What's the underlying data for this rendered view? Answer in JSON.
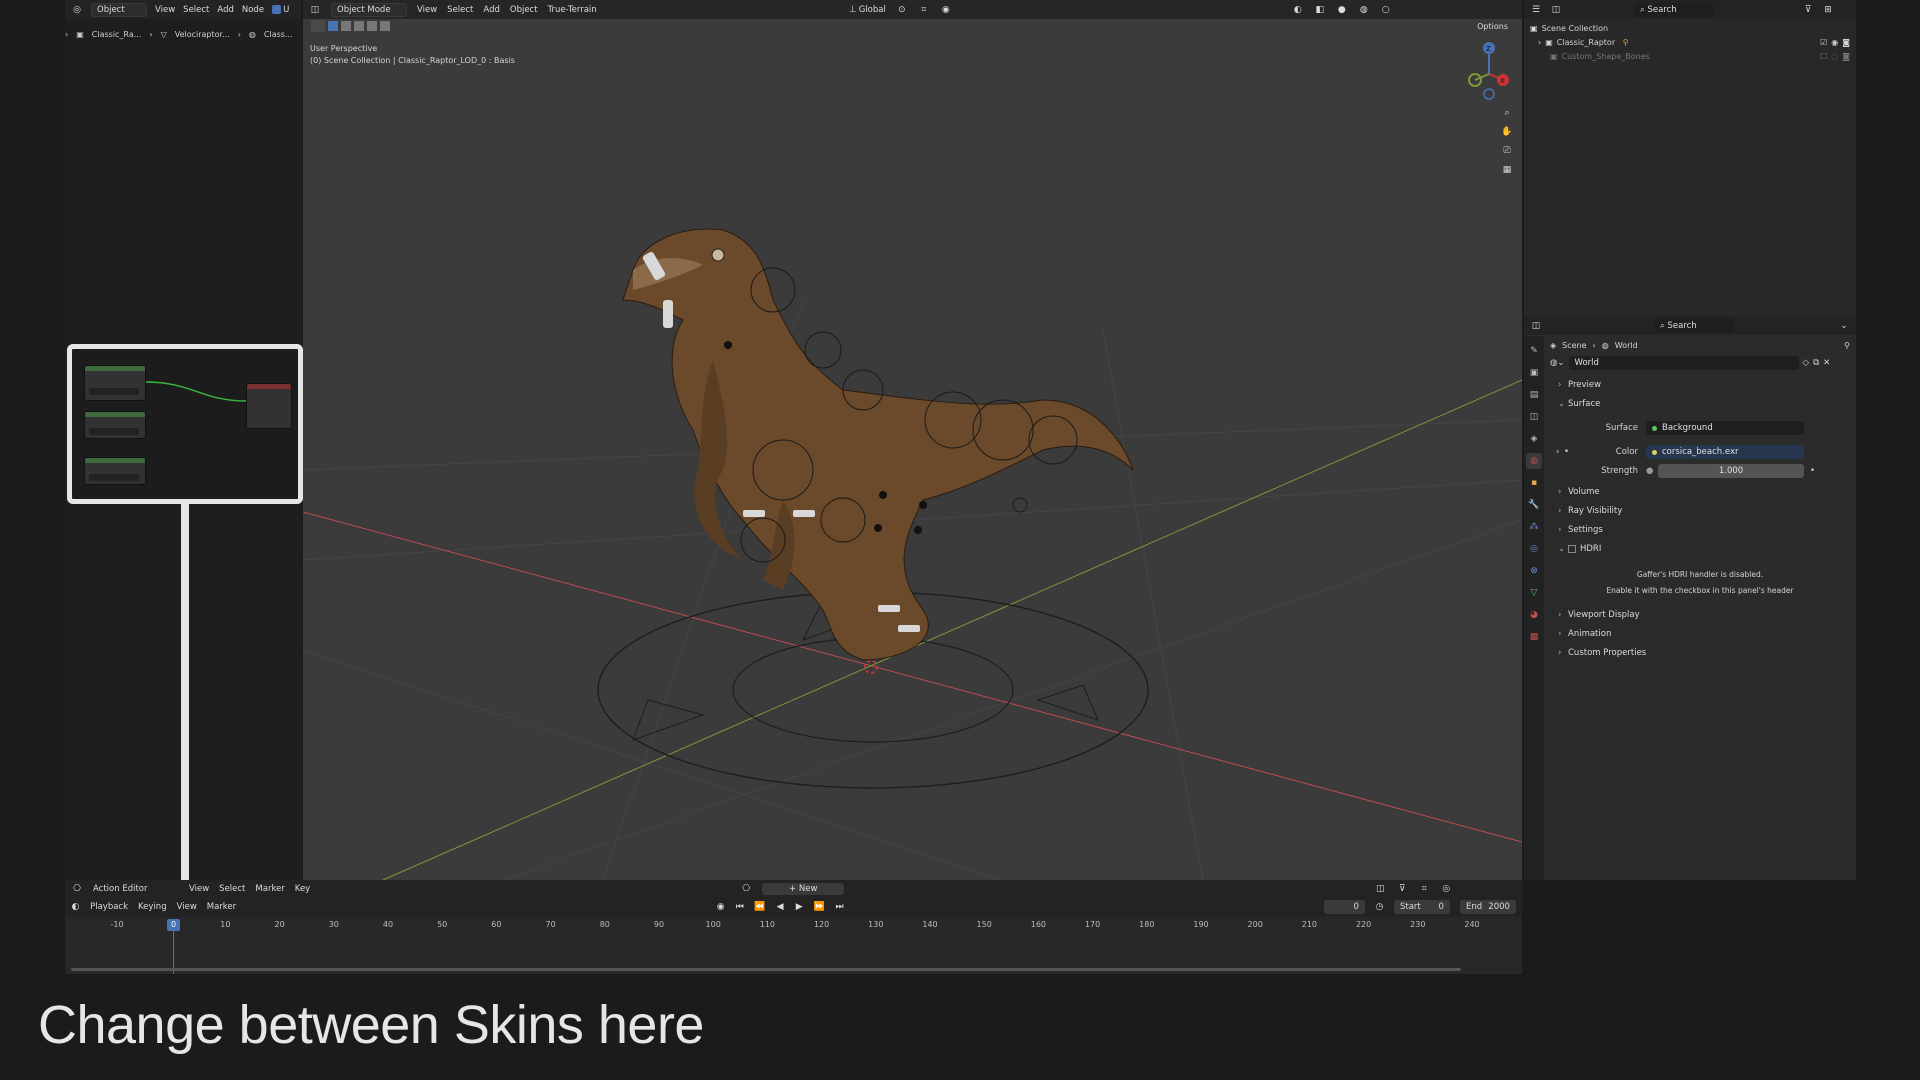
{
  "node_editor": {
    "header": {
      "mode": "Object",
      "menus": [
        "View",
        "Select",
        "Add",
        "Node"
      ],
      "checkbox_label": "U"
    },
    "breadcrumb": [
      "Classic_Ra...",
      "Velociraptor...",
      "Class..."
    ]
  },
  "viewport": {
    "header": {
      "mode": "Object Mode",
      "menus": [
        "View",
        "Select",
        "Add",
        "Object",
        "True-Terrain"
      ],
      "transform_orientation": "Global",
      "options_label": "Options"
    },
    "info_line1": "User Perspective",
    "info_line2": "(0) Scene Collection | Classic_Raptor_LOD_0 : Basis",
    "gizmo": {
      "x": "X",
      "y": "Y",
      "z": "Z"
    }
  },
  "outliner": {
    "search_placeholder": "Search",
    "items": [
      {
        "label": "Scene Collection"
      },
      {
        "label": "Classic_Raptor"
      },
      {
        "label": "Custom_Shape_Bones"
      }
    ]
  },
  "properties": {
    "search_placeholder": "Search",
    "breadcrumb": [
      "Scene",
      "World"
    ],
    "datablock": "World",
    "sections": {
      "preview": "Preview",
      "surface": "Surface",
      "volume": "Volume",
      "ray_visibility": "Ray Visibility",
      "settings": "Settings",
      "hdri": "HDRI",
      "viewport_display": "Viewport Display",
      "animation": "Animation",
      "custom_properties": "Custom Properties"
    },
    "surface_label": "Surface",
    "surface_value": "Background",
    "color_label": "Color",
    "color_value": "corsica_beach.exr",
    "strength_label": "Strength",
    "strength_value": "1.000",
    "hdri_msg1": "Gaffer's HDRI handler is disabled.",
    "hdri_msg2": "Enable it with the checkbox in this panel's header"
  },
  "action_editor": {
    "mode": "Action Editor",
    "menus": [
      "View",
      "Select",
      "Marker",
      "Key"
    ],
    "new_label": "New",
    "playback": "Playback",
    "keying": "Keying",
    "sub_menus": [
      "View",
      "Marker"
    ],
    "current_frame": "0",
    "start_label": "Start",
    "start_value": "0",
    "end_label": "End",
    "end_value": "2000",
    "playhead_label": "0",
    "ticks": [
      "-10",
      "10",
      "20",
      "30",
      "40",
      "50",
      "60",
      "70",
      "80",
      "90",
      "100",
      "110",
      "120",
      "130",
      "140",
      "150",
      "160",
      "170",
      "180",
      "190",
      "200",
      "210",
      "220",
      "230",
      "240"
    ]
  },
  "caption": "Change between Skins here",
  "colors": {
    "accent_blue": "#4772b3",
    "callout_border": "#e6e6e6",
    "x_axis": "#c04a52",
    "y_axis": "#7a9a3a"
  }
}
